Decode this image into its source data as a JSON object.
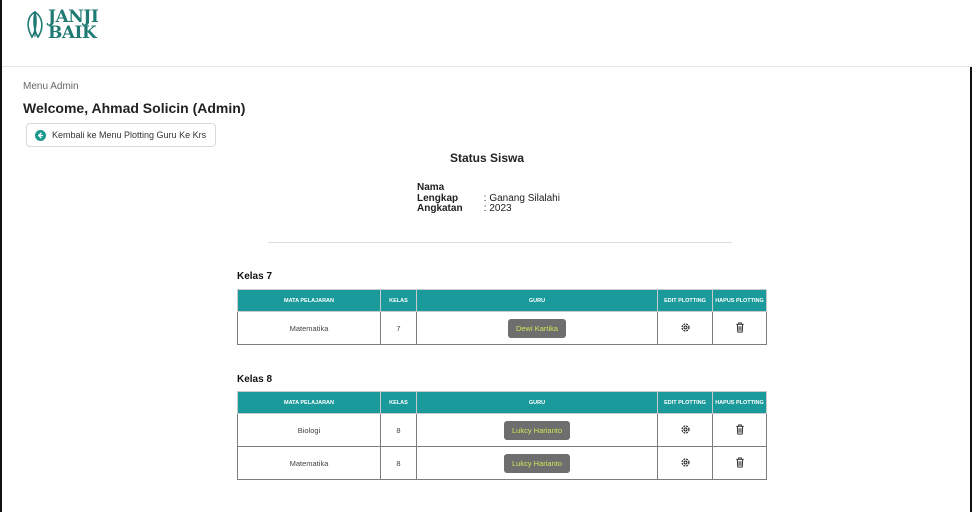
{
  "brand": {
    "line1": "JANJI",
    "line2": "BAIK",
    "color": "#1f7a73"
  },
  "breadcrumb": "Menu Admin",
  "welcome": "Welcome, Ahmad Solicin (Admin)",
  "back_button": {
    "label": "Kembali ke Menu Plotting Guru Ke Krs",
    "icon": "arrow-left-circle-icon"
  },
  "status": {
    "title": "Status Siswa",
    "name_label": "Nama Lengkap",
    "name_value": ": Ganang Silalahi",
    "year_label": "Angkatan",
    "year_value": ": 2023"
  },
  "columns": [
    "MATA PELAJARAN",
    "KELAS",
    "GURU",
    "EDIT PLOTTING",
    "HAPUS PLOTTING"
  ],
  "sections": [
    {
      "title": "Kelas 7",
      "rows": [
        {
          "subject": "Matematika",
          "kelas": "7",
          "guru": "Dewi Kartika"
        }
      ]
    },
    {
      "title": "Kelas 8",
      "rows": [
        {
          "subject": "Biologi",
          "kelas": "8",
          "guru": "Lukcy Harianto"
        },
        {
          "subject": "Matematika",
          "kelas": "8",
          "guru": "Lukcy Harianto"
        }
      ]
    }
  ],
  "icons": {
    "edit": "gear-icon",
    "delete": "trash-icon"
  },
  "colors": {
    "header_teal": "#1a9a9a",
    "guru_button_bg": "#6e6e6e",
    "guru_button_text": "#c8e85a"
  }
}
